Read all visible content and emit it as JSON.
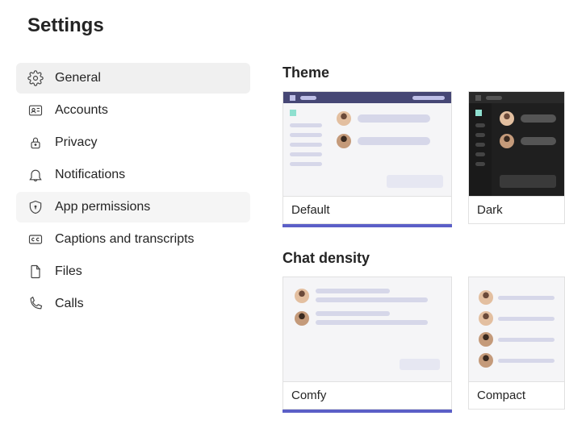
{
  "title": "Settings",
  "sidebar": {
    "items": [
      {
        "id": "general",
        "label": "General",
        "icon": "gear-icon",
        "state": "active"
      },
      {
        "id": "accounts",
        "label": "Accounts",
        "icon": "id-card-icon",
        "state": ""
      },
      {
        "id": "privacy",
        "label": "Privacy",
        "icon": "lock-icon",
        "state": ""
      },
      {
        "id": "notifications",
        "label": "Notifications",
        "icon": "bell-icon",
        "state": ""
      },
      {
        "id": "app-permissions",
        "label": "App permissions",
        "icon": "shield-icon",
        "state": "hover"
      },
      {
        "id": "captions",
        "label": "Captions and transcripts",
        "icon": "cc-icon",
        "state": ""
      },
      {
        "id": "files",
        "label": "Files",
        "icon": "file-icon",
        "state": ""
      },
      {
        "id": "calls",
        "label": "Calls",
        "icon": "phone-icon",
        "state": ""
      }
    ]
  },
  "sections": {
    "theme": {
      "title": "Theme",
      "options": [
        {
          "id": "default",
          "label": "Default",
          "selected": true
        },
        {
          "id": "dark",
          "label": "Dark",
          "selected": false
        }
      ]
    },
    "chatDensity": {
      "title": "Chat density",
      "options": [
        {
          "id": "comfy",
          "label": "Comfy",
          "selected": true
        },
        {
          "id": "compact",
          "label": "Compact",
          "selected": false
        }
      ]
    }
  },
  "colors": {
    "accent": "#5b5fc7",
    "headerBar": "#464775"
  }
}
